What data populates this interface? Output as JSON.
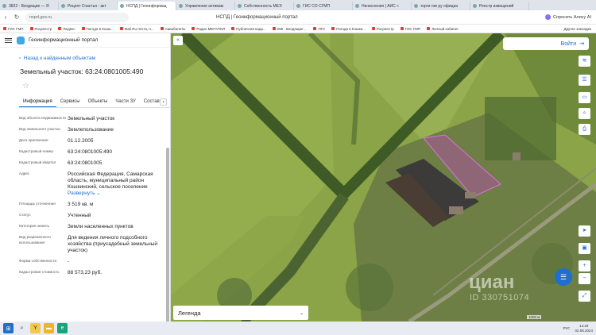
{
  "browser": {
    "tabs": [
      {
        "label": "3822 - Входящие — Я"
      },
      {
        "label": "Рецепт Счастья - акт"
      },
      {
        "label": "НСПД | Геоинформац",
        "active": true
      },
      {
        "label": "Управление активам"
      },
      {
        "label": "Собственность МЕЭ"
      },
      {
        "label": "ГИС СО СГМП"
      },
      {
        "label": "Начисления | АИС «"
      },
      {
        "label": "торги гов ру официа"
      },
      {
        "label": "Реестр извещений"
      }
    ],
    "url": "nspd.gov.ru",
    "page_title": "НСПД | Геоинформационный портал",
    "alice_label": "Спросить Алису AI",
    "bookmarks": [
      "ГИС ГМП",
      "Росреестр",
      "Яндекс",
      "Погода в Кошк...",
      "Mail.Ru почта, п...",
      "Авиабилеты",
      "Радио МЕГАПОЛ",
      "Публичная када...",
      "296 - Входящие ...",
      "ПГС",
      "Погода в Кошки...",
      "Росреестр",
      "ГИС ГМП",
      "Личный кабинет"
    ],
    "bookmarks_other": "Другие закладки"
  },
  "sidebar": {
    "portal_name": "Геоинформационный портал",
    "back_label": "Назад к найденным объектам",
    "title": "Земельный участок: 63:24:0801005:490",
    "tabs": [
      "Информация",
      "Сервисы",
      "Объекты",
      "Части ЗУ",
      "Состав"
    ],
    "attributes": [
      {
        "key": "Вид объекта недвижимости",
        "value": "Земельный участок"
      },
      {
        "key": "Вид земельного участка",
        "value": "Землепользование"
      },
      {
        "key": "Дата присвоения",
        "value": "01.12.2005"
      },
      {
        "key": "Кадастровый номер",
        "value": "63:24:0801005:490"
      },
      {
        "key": "Кадастровый квартал",
        "value": "63:24:0801005"
      },
      {
        "key": "Адрес",
        "value": "Российская Федерация, Самарская область, муниципальный район Кошкинский, сельское поселение",
        "expand": "Развернуть"
      },
      {
        "key": "Площадь уточненная",
        "value": "3 519 кв. м"
      },
      {
        "key": "Статус",
        "value": "Учтенный"
      },
      {
        "key": "Категория земель",
        "value": "Земли населенных пунктов"
      },
      {
        "key": "Вид разрешенного использования",
        "value": "Для ведения личного подсобного хозяйства (приусадебный земельный участок)"
      },
      {
        "key": "Форма собственности",
        "value": "-"
      },
      {
        "key": "Кадастровая стоимость",
        "value": "88 573,23 руб."
      }
    ]
  },
  "map": {
    "login_label": "Войти",
    "legend_label": "Легенда",
    "watermark": "циан",
    "watermark_id": "ID 330751074",
    "scale_label": "1000 м",
    "highlight_color": "#c040c0"
  },
  "taskbar": {
    "lang": "РУС",
    "time": "14:29",
    "date": "02.08.2024"
  }
}
